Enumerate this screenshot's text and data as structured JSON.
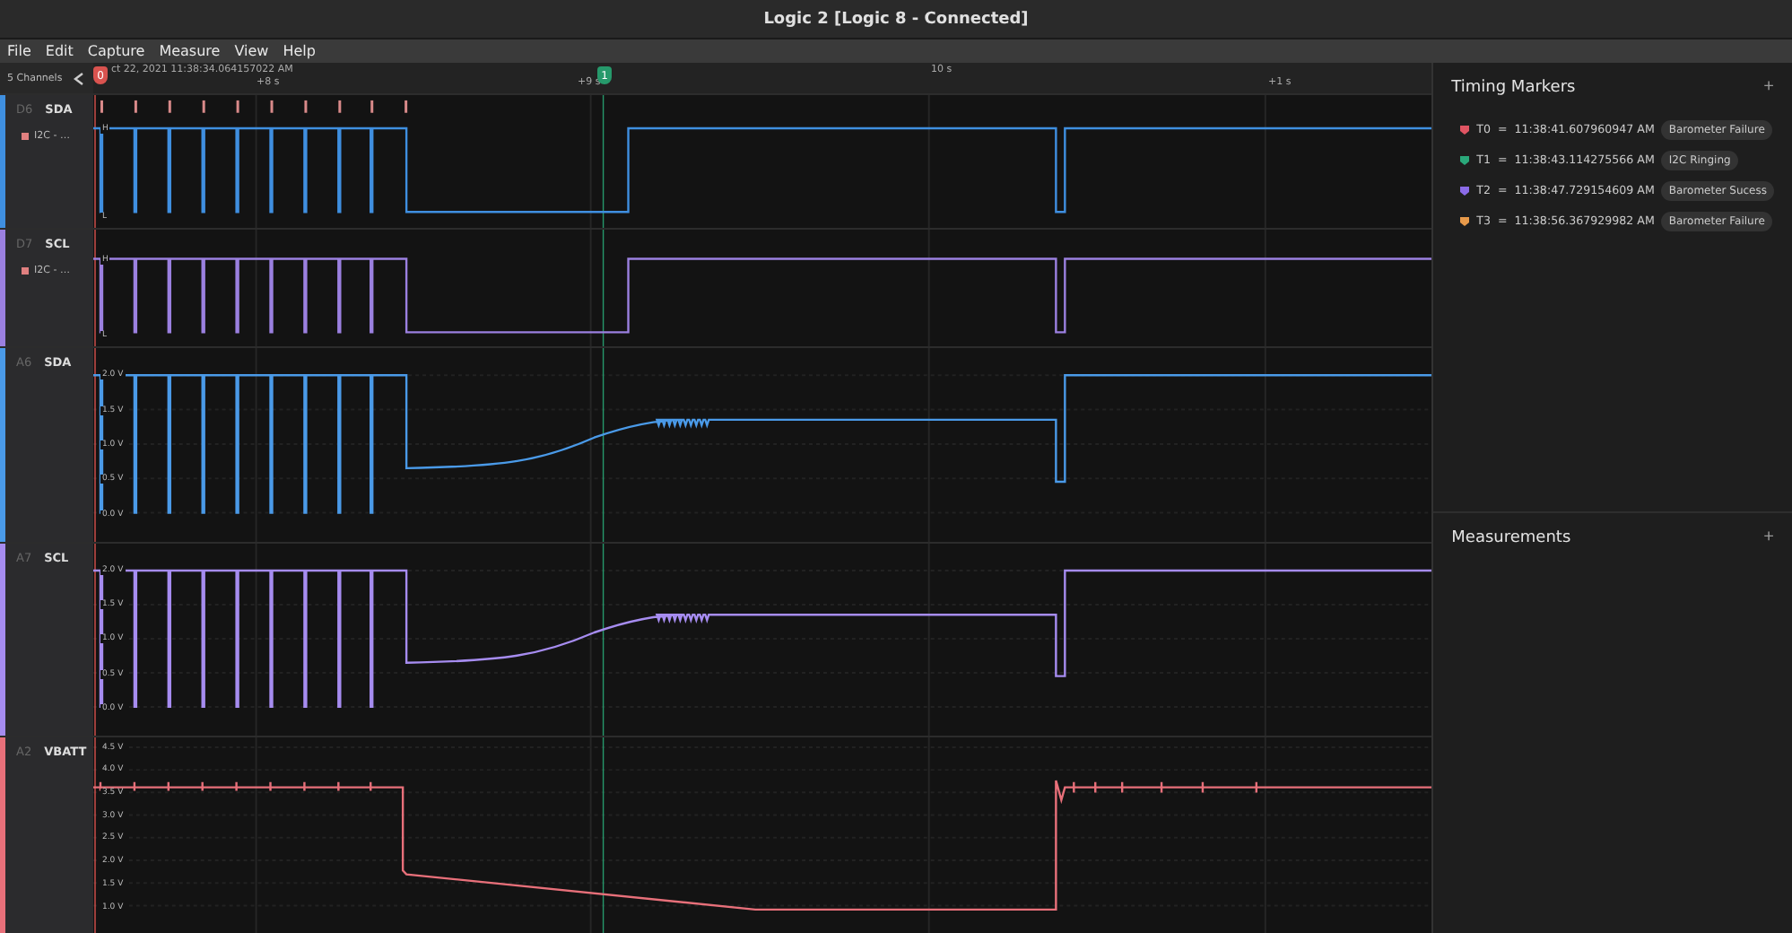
{
  "window": {
    "title": "Logic 2 [Logic 8 - Connected]"
  },
  "menu": [
    "File",
    "Edit",
    "Capture",
    "Measure",
    "View",
    "Help"
  ],
  "channel_count": "5 Channels",
  "timeline": {
    "start": "ct 22, 2021 11:38:34.064157022 AM",
    "ticks": [
      {
        "label": "+8 s"
      },
      {
        "label": "+9 s"
      },
      {
        "label": "10 s"
      },
      {
        "label": "+1 s"
      }
    ],
    "markers": [
      {
        "label": "0",
        "color": "#d9534f"
      },
      {
        "label": "1",
        "color": "#26996b"
      }
    ]
  },
  "channels": [
    {
      "id": "D6",
      "name": "SDA",
      "kind": "digital",
      "color": "#3f8fe0",
      "analyzer": "I2C - …",
      "high": "H",
      "low": "L",
      "decoded": true
    },
    {
      "id": "D7",
      "name": "SCL",
      "kind": "digital",
      "color": "#9b80e0",
      "analyzer": "I2C - …",
      "high": "H",
      "low": "L",
      "decoded": false
    },
    {
      "id": "A6",
      "name": "SDA",
      "kind": "bus",
      "color": "#4a9ae8",
      "axis": [
        "2.0 V",
        "1.5 V",
        "1.0 V",
        "0.5 V",
        "0.0 V"
      ]
    },
    {
      "id": "A7",
      "name": "SCL",
      "kind": "bus",
      "color": "#a68cf0",
      "axis": [
        "2.0 V",
        "1.5 V",
        "1.0 V",
        "0.5 V",
        "0.0 V"
      ]
    },
    {
      "id": "A2",
      "name": "VBATT",
      "kind": "supply",
      "color": "#e8707a",
      "axis": [
        "4.5 V",
        "4.0 V",
        "3.5 V",
        "3.0 V",
        "2.5 V",
        "2.0 V",
        "1.5 V",
        "1.0 V"
      ]
    }
  ],
  "timing_markers": {
    "title": "Timing Markers",
    "add": "+",
    "items": [
      {
        "name": "T0",
        "relation": "=",
        "time": "11:38:41.607960947 AM",
        "note": "Barometer Failure",
        "color": "#e05563"
      },
      {
        "name": "T1",
        "relation": "=",
        "time": "11:38:43.114275566 AM",
        "note": "I2C Ringing",
        "color": "#2aa87a"
      },
      {
        "name": "T2",
        "relation": "=",
        "time": "11:38:47.729154609 AM",
        "note": "Barometer Sucess",
        "color": "#8b6be8"
      },
      {
        "name": "T3",
        "relation": "=",
        "time": "11:38:56.367929982 AM",
        "note": "Barometer Failure",
        "color": "#e89a4a"
      }
    ]
  },
  "measurements": {
    "title": "Measurements",
    "add": "+"
  }
}
